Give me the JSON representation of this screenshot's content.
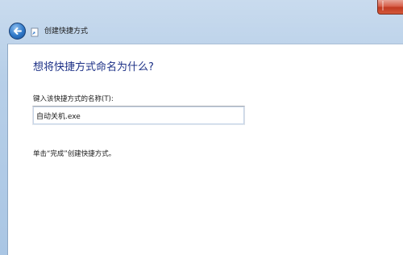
{
  "window": {
    "title": "创建快捷方式",
    "back_icon": "back-arrow-icon",
    "close_icon": "close-icon"
  },
  "content": {
    "heading": "想将快捷方式命名为什么?",
    "field_label": "键入该快捷方式的名称(T):",
    "name_value": "自动关机.exe",
    "hint": "单击“完成”创建快捷方式。"
  },
  "colors": {
    "heading": "#1e3287",
    "frame": "#b9d1ea",
    "close_button": "#c13a22"
  }
}
